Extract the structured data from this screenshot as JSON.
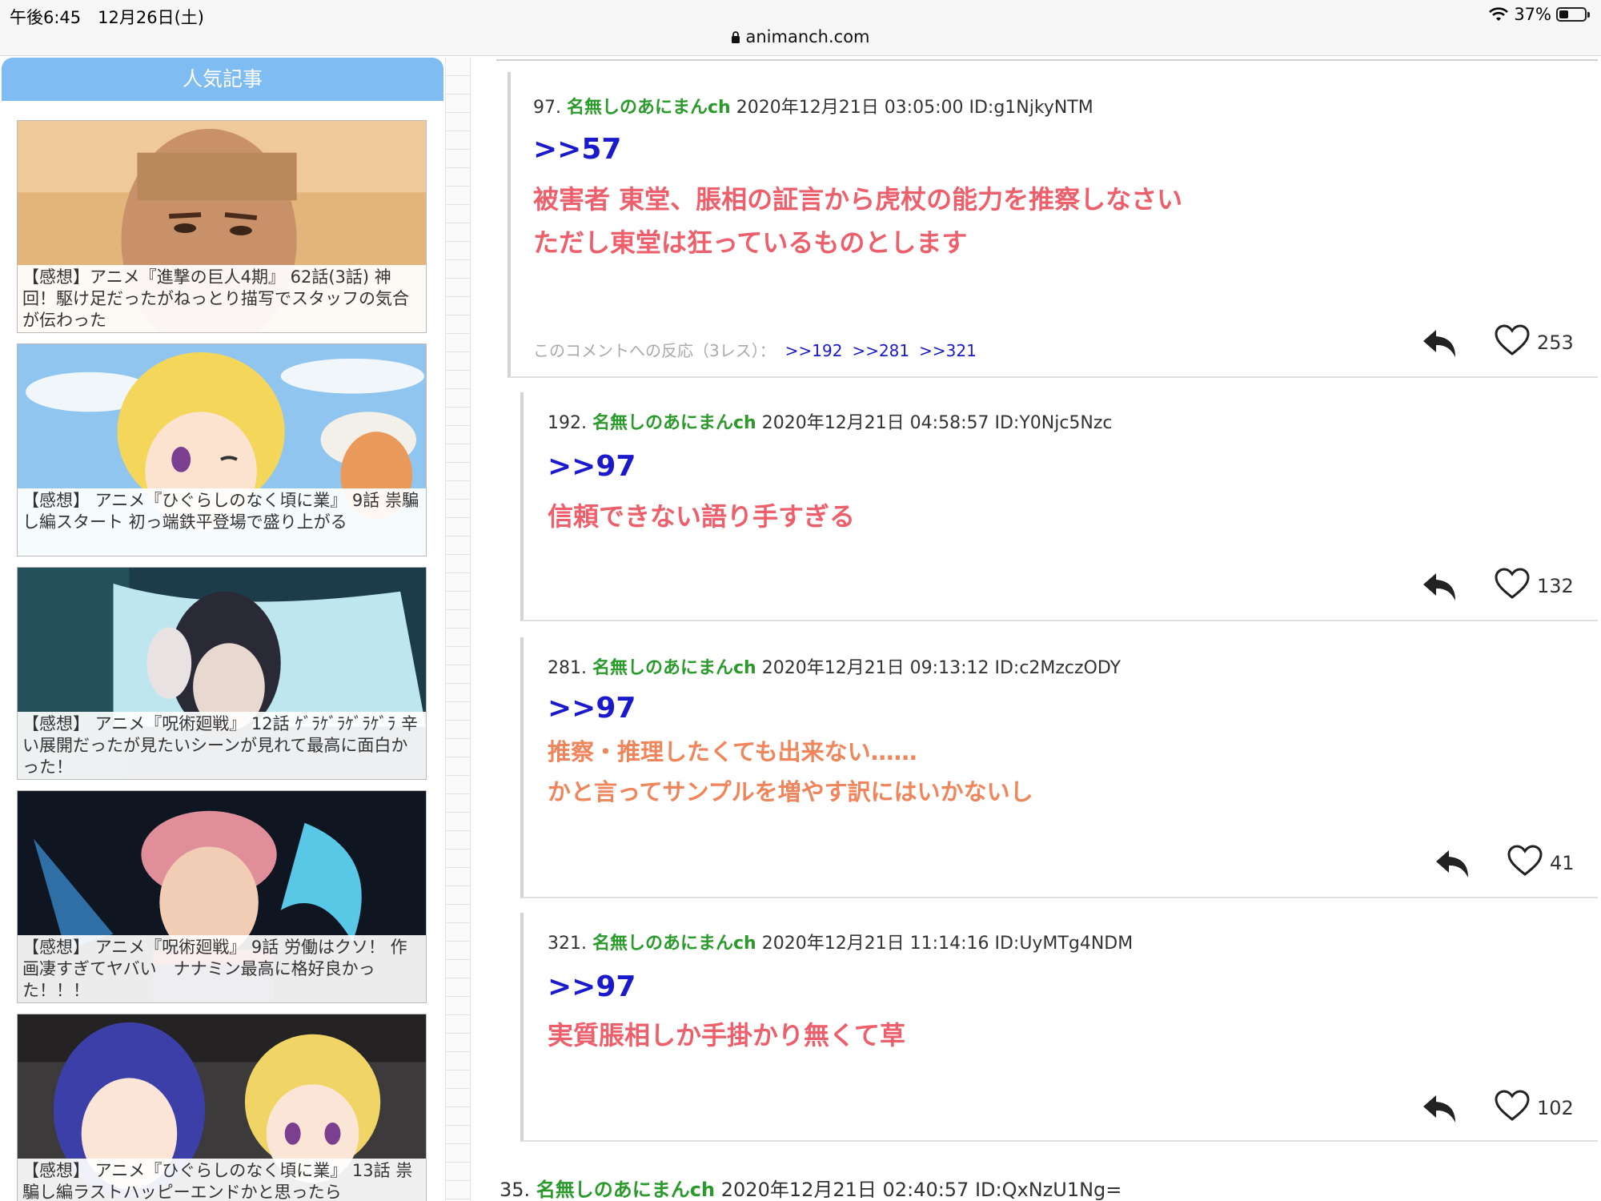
{
  "status": {
    "time": "午後6:45　12月26日(土)",
    "battery": "37%",
    "battery_level": 0.37,
    "url": "animanch.com"
  },
  "sidebar": {
    "title": "人気記事",
    "articles": [
      {
        "caption": "【感想】アニメ『進撃の巨人4期』 62話(3話) 神回！駆け足だったがねっとり描写でスタッフの気合が伝わった"
      },
      {
        "caption": "【感想】 アニメ『ひぐらしのなく頃に業』 9話 祟騙し編スタート 初っ端鉄平登場で盛り上がる"
      },
      {
        "caption": "【感想】 アニメ『呪術廻戦』 12話 ｹﾞﾗｹﾞﾗｹﾞﾗｹﾞﾗ 辛い展開だったが見たいシーンが見れて最高に面白かった！"
      },
      {
        "caption": "【感想】 アニメ『呪術廻戦』 9話 労働はクソ！ 作画凄すぎてヤバい　ナナミン最高に格好良かった！！！"
      },
      {
        "caption": "【感想】 アニメ『ひぐらしのなく頃に業』 13話 祟騙し編ラストハッピーエンドかと思ったら"
      }
    ]
  },
  "comments": [
    {
      "number": "97.",
      "name": "名無しのあにまんch",
      "date": "2020年12月21日 03:05:00 ID:g1NjkyNTM",
      "anchor": ">>57",
      "lines": [
        "被害者 東堂、脹相の証言から虎杖の能力を推察しなさい",
        "ただし東堂は狂っているものとします"
      ],
      "reactions_label": "このコメントへの反応（3レス）：",
      "reaction_links": [
        ">>192",
        ">>281",
        ">>321"
      ],
      "likes": "253"
    },
    {
      "number": "192.",
      "name": "名無しのあにまんch",
      "date": "2020年12月21日 04:58:57 ID:Y0Njc5Nzc",
      "anchor": ">>97",
      "lines": [
        "信頼できない語り手すぎる"
      ],
      "likes": "132"
    },
    {
      "number": "281.",
      "name": "名無しのあにまんch",
      "date": "2020年12月21日 09:13:12 ID:c2MzczODY",
      "anchor": ">>97",
      "lines": [
        "推察・推理したくても出来ない……",
        "かと言ってサンプルを増やす訳にはいかないし"
      ],
      "likes": "41"
    },
    {
      "number": "321.",
      "name": "名無しのあにまんch",
      "date": "2020年12月21日 11:14:16 ID:UyMTg4NDM",
      "anchor": ">>97",
      "lines": [
        "実質脹相しか手掛かり無くて草"
      ],
      "likes": "102"
    }
  ],
  "next_comment": {
    "number": "35.",
    "name": "名無しのあにまんch",
    "date": "2020年12月21日 02:40:57 ID:QxNzU1Ng="
  }
}
